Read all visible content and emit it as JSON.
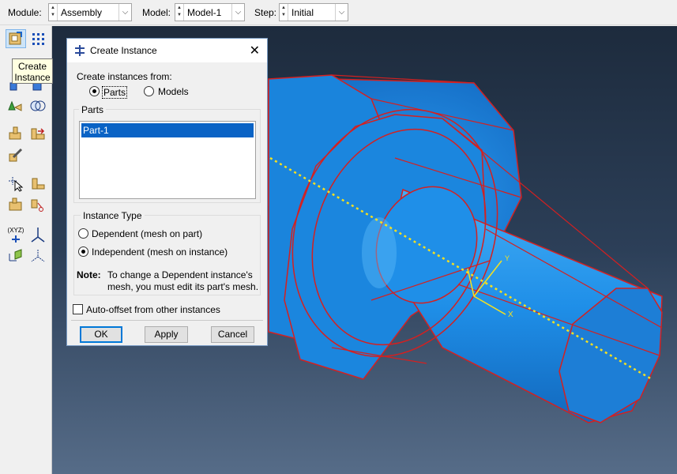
{
  "topbar": {
    "module_label": "Module:",
    "module_value": "Assembly",
    "model_label": "Model:",
    "model_value": "Model-1",
    "step_label": "Step:",
    "step_value": "Initial"
  },
  "tooltip": {
    "line1": "Create",
    "line2": "Instance"
  },
  "toolbox": {
    "icons": [
      "create-instance-icon",
      "linear-pattern-icon",
      "translate-instance-icon",
      "rotate-instance-icon",
      "radial-pattern-icon",
      "merge-cut-icon",
      "create-constraint-icon",
      "position-constraint-icon",
      "edit-feature-icon",
      "query-icon",
      "datum-icon",
      "partition-icon",
      "set-icon",
      "coordinate-system-icon",
      "csys-icon",
      "axis-icon",
      "surface-icon"
    ],
    "csys_text": "(XYZ)"
  },
  "dialog": {
    "title": "Create Instance",
    "create_from_label": "Create instances from:",
    "source_options": [
      {
        "label": "Parts",
        "selected": true
      },
      {
        "label": "Models",
        "selected": false
      }
    ],
    "parts_group_title": "Parts",
    "parts": [
      "Part-1"
    ],
    "instance_type_title": "Instance Type",
    "instance_types": [
      {
        "label": "Dependent (mesh on part)",
        "selected": false
      },
      {
        "label": "Independent (mesh on instance)",
        "selected": true
      }
    ],
    "note_label": "Note:",
    "note_line1": "To change a Dependent instance's",
    "note_line2": "mesh, you must edit its part's mesh.",
    "auto_offset_label": "Auto-offset from other instances",
    "auto_offset_checked": false,
    "ok_label": "OK",
    "apply_label": "Apply",
    "cancel_label": "Cancel"
  },
  "viewport": {
    "triad_x": "X",
    "triad_y": "Y",
    "part_color": "#1f8fe8",
    "edge_color": "#d42020",
    "axis_color": "#f5e020"
  }
}
